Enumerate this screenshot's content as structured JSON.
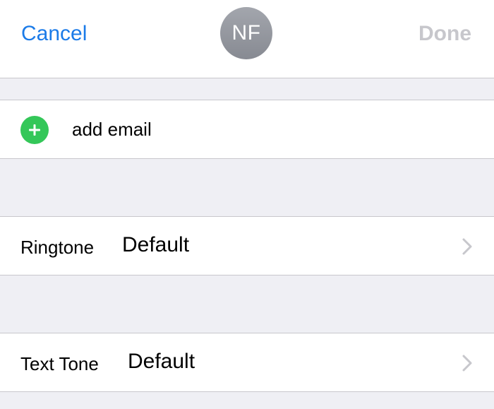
{
  "header": {
    "cancel_label": "Cancel",
    "avatar_initials": "NF",
    "done_label": "Done"
  },
  "email_row": {
    "label": "add email"
  },
  "ringtone_row": {
    "label": "Ringtone",
    "value": "Default"
  },
  "texttone_row": {
    "label": "Text Tone",
    "value": "Default"
  },
  "colors": {
    "accent": "#1b7be8",
    "add": "#34c759",
    "disabled": "#c7c7cc",
    "background": "#efeff4"
  },
  "icons": {
    "add": "plus-circle-icon",
    "disclosure": "chevron-right-icon"
  }
}
